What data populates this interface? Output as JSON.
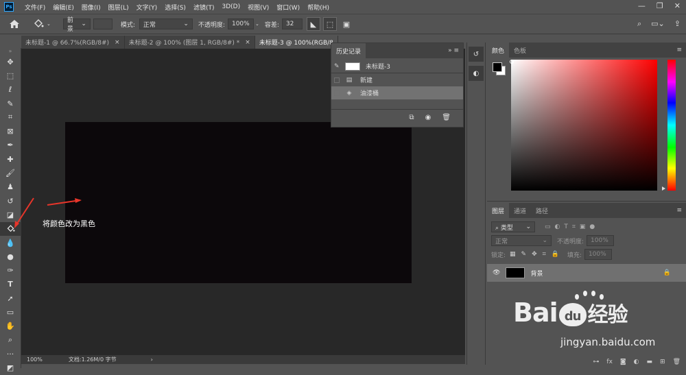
{
  "app": {
    "logo": "Ps"
  },
  "menu": [
    "文件(F)",
    "编辑(E)",
    "图像(I)",
    "图层(L)",
    "文字(Y)",
    "选择(S)",
    "滤镜(T)",
    "3D(D)",
    "视图(V)",
    "窗口(W)",
    "帮助(H)"
  ],
  "options": {
    "fill_source": "前景",
    "mode_label": "模式:",
    "mode_value": "正常",
    "opacity_label": "不透明度:",
    "opacity_value": "100%",
    "tolerance_label": "容差:",
    "tolerance_value": "32"
  },
  "doc_tabs": [
    {
      "label": "未标题-1 @ 66.7%(RGB/8#)",
      "close": "×"
    },
    {
      "label": "未标题-2 @ 100% (图层 1, RGB/8#) *",
      "close": "×"
    },
    {
      "label": "未标题-3 @ 100%(RGB/8",
      "close": ""
    }
  ],
  "status": {
    "zoom": "100%",
    "doc": "文档:1.26M/0 字节"
  },
  "annotation": "将颜色改为黑色",
  "history": {
    "tab": "历史记录",
    "snapshot": "未标题-3",
    "items": [
      "新建",
      "油漆桶"
    ]
  },
  "color_panel": {
    "tabs": [
      "颜色",
      "色板"
    ],
    "foreground": "#000000",
    "background": "#ffffff"
  },
  "layers_panel": {
    "tabs": [
      "图层",
      "通道",
      "路径"
    ],
    "filter": "类型",
    "blend": "正常",
    "opacity_label": "不透明度:",
    "opacity_value": "100%",
    "lock_label": "锁定:",
    "fill_label": "填充:",
    "fill_value": "100%",
    "layer_name": "背景"
  },
  "watermark": {
    "brand": "Bai",
    "paw": "du",
    "cn": "经验",
    "url": "jingyan.baidu.com"
  }
}
